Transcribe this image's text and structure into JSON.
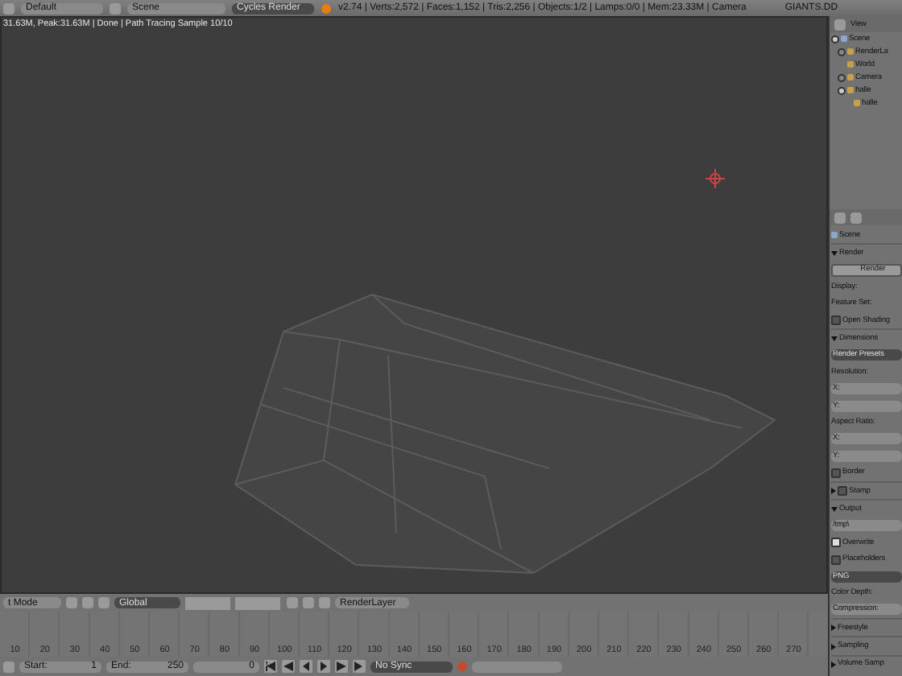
{
  "info_header": {
    "layout": "Default",
    "scene": "Scene",
    "engine": "Cycles Render",
    "stats": "v2.74 | Verts:2,572 | Faces:1,152 | Tris:2,256 | Objects:1/2 | Lamps:0/0 | Mem:23.33M | Camera",
    "file": "GIANTS.DD"
  },
  "viewport": {
    "render_info": "31.63M, Peak:31.63M | Done | Path Tracing Sample 10/10"
  },
  "view3d_header": {
    "mode": "t Mode",
    "orientation": "Global",
    "layer": "RenderLayer"
  },
  "timeline": {
    "ticks": [
      "10",
      "20",
      "30",
      "40",
      "50",
      "60",
      "70",
      "80",
      "90",
      "100",
      "110",
      "120",
      "130",
      "140",
      "150",
      "160",
      "170",
      "180",
      "190",
      "200",
      "210",
      "220",
      "230",
      "240",
      "250",
      "260",
      "270"
    ],
    "start_label": "Start:",
    "start": "1",
    "end_label": "End:",
    "end": "250",
    "frame": "0",
    "sync": "No Sync"
  },
  "outliner": {
    "menu": "View",
    "tree": [
      {
        "label": "Scene",
        "expanded": true,
        "children": [
          {
            "label": "RenderLa",
            "expanded": false
          },
          {
            "label": "World"
          },
          {
            "label": "Camera",
            "expanded": false
          },
          {
            "label": "halle",
            "expanded": true,
            "children": [
              {
                "label": "halle"
              }
            ]
          }
        ]
      }
    ]
  },
  "properties": {
    "context": "Scene",
    "rows": [
      {
        "kind": "header",
        "label": "Render",
        "expanded": true
      },
      {
        "kind": "button",
        "label": "Render"
      },
      {
        "kind": "label",
        "label": "Display:"
      },
      {
        "kind": "label",
        "label": "Feature Set:"
      },
      {
        "kind": "checkbox",
        "label": "Open Shading",
        "checked": false
      },
      {
        "kind": "header",
        "label": "Dimensions",
        "expanded": true
      },
      {
        "kind": "menu",
        "label": "Render Presets"
      },
      {
        "kind": "label",
        "label": "Resolution:"
      },
      {
        "kind": "field",
        "label": "X:"
      },
      {
        "kind": "field",
        "label": "Y:"
      },
      {
        "kind": "label",
        "label": "Aspect Ratio:"
      },
      {
        "kind": "field",
        "label": "X:"
      },
      {
        "kind": "field",
        "label": "Y:"
      },
      {
        "kind": "checkbox",
        "label": "Border",
        "checked": false
      },
      {
        "kind": "header",
        "label": "Stamp",
        "expanded": false,
        "checked": false
      },
      {
        "kind": "header",
        "label": "Output",
        "expanded": true
      },
      {
        "kind": "field",
        "label": "/tmp\\"
      },
      {
        "kind": "checkbox",
        "label": "Overwrite",
        "checked": true
      },
      {
        "kind": "checkbox",
        "label": "Placeholders",
        "checked": false
      },
      {
        "kind": "menu",
        "label": "PNG"
      },
      {
        "kind": "label",
        "label": "Color Depth:"
      },
      {
        "kind": "field",
        "label": "Compression:"
      },
      {
        "kind": "header",
        "label": "Freestyle",
        "expanded": false
      },
      {
        "kind": "header",
        "label": "Sampling",
        "expanded": false
      },
      {
        "kind": "header",
        "label": "Volume Samp",
        "expanded": false
      }
    ]
  }
}
